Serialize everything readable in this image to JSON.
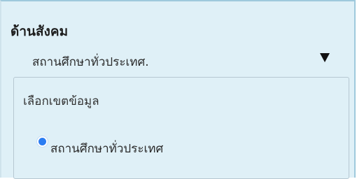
{
  "section": {
    "title": "ด้านสังคม"
  },
  "scope_select": {
    "selected_value": "สถานศึกษาทั่วประเทศ.",
    "icon": "dropdown-arrow-icon"
  },
  "filter": {
    "label": "เลือกเขตข้อมูล",
    "options": [
      {
        "label": "สถานศึกษาทั่วประเทศ",
        "selected": true
      }
    ]
  },
  "colors": {
    "panel_background": "#dff0f7",
    "radio_selected": "#2b7df2"
  }
}
